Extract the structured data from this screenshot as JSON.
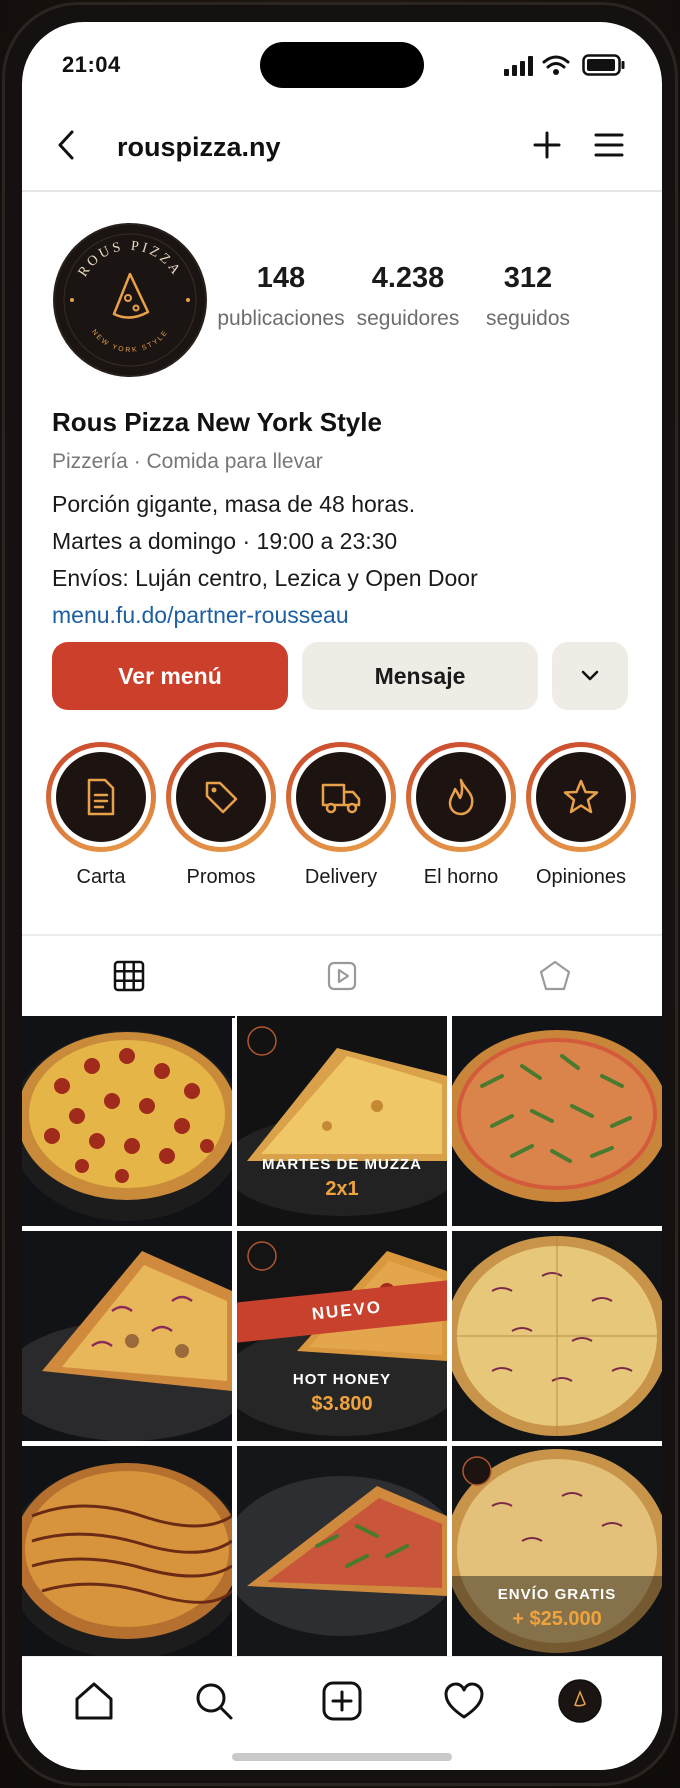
{
  "status_bar": {
    "time": "21:04"
  },
  "header": {
    "username": "rouspizza.ny"
  },
  "profile": {
    "avatar_text": "ROUS PIZZA",
    "avatar_subtext": "NEW YORK STYLE",
    "stats": [
      {
        "value": "148",
        "label": "publicaciones"
      },
      {
        "value": "4.238",
        "label": "seguidores"
      },
      {
        "value": "312",
        "label": "seguidos"
      }
    ],
    "name": "Rous Pizza New York Style",
    "category": "Pizzería · Comida para llevar",
    "bio_lines": [
      "Porción gigante, masa de 48 horas.",
      "Martes a domingo · 19:00 a 23:30",
      "Envíos: Luján centro, Lezica y Open Door"
    ],
    "link": "menu.fu.do/partner-rousseau"
  },
  "buttons": {
    "primary": "Ver menú",
    "secondary": "Mensaje"
  },
  "highlights": [
    {
      "label": "Carta",
      "icon": "document-icon"
    },
    {
      "label": "Promos",
      "icon": "tag-icon"
    },
    {
      "label": "Delivery",
      "icon": "truck-icon"
    },
    {
      "label": "El horno",
      "icon": "flame-icon"
    },
    {
      "label": "Opiniones",
      "icon": "star-icon"
    }
  ],
  "tabs": [
    "grid-icon",
    "reels-icon",
    "tagged-icon"
  ],
  "posts": [
    {
      "kind": "pepperoni-pizza"
    },
    {
      "kind": "promo",
      "line1": "MARTES DE MUZZA",
      "line2": "2x1"
    },
    {
      "kind": "arugula-pizza"
    },
    {
      "kind": "slice"
    },
    {
      "kind": "promo",
      "ribbon": "NUEVO",
      "line1": "HOT HONEY",
      "line2": "$3.800"
    },
    {
      "kind": "onion-pizza"
    },
    {
      "kind": "bbq-pizza"
    },
    {
      "kind": "arugula-slice"
    },
    {
      "kind": "promo",
      "line1": "ENVÍO GRATIS",
      "line2": "+ $25.000"
    }
  ],
  "colors": {
    "accent": "#cc3f2b",
    "gold": "#e8a04a",
    "dark": "#1d1412",
    "link": "#1d5fa0"
  }
}
